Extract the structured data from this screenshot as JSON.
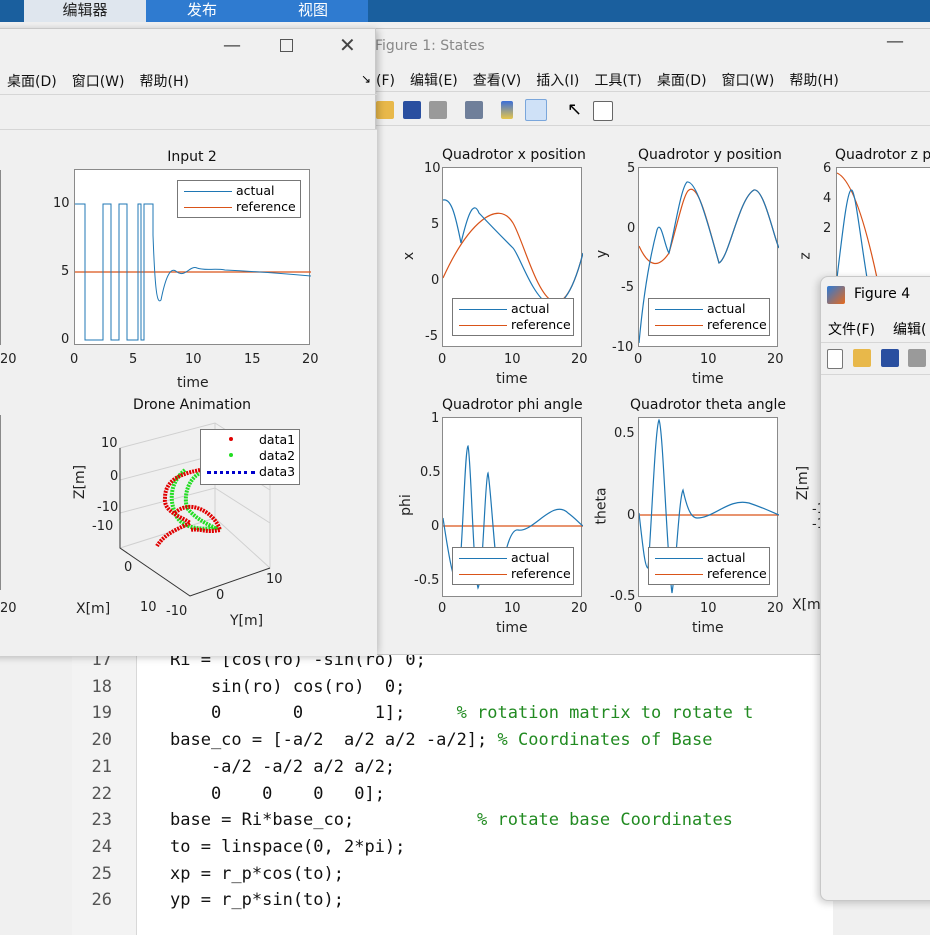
{
  "ribbon": {
    "tabs": [
      "编辑器",
      "发布",
      "视图"
    ]
  },
  "figure_left": {
    "menu": [
      "桌面(D)",
      "窗口(W)",
      "帮助(H)"
    ],
    "input2": {
      "title": "Input 2",
      "xlabel": "time",
      "xticks": [
        "0",
        "5",
        "10",
        "15",
        "20"
      ],
      "yticks": [
        "10",
        "5",
        "0"
      ],
      "legend": [
        "actual",
        "reference"
      ],
      "left_cut_xtick": "20"
    },
    "drone": {
      "title": "Drone Animation",
      "zlabel": "Z[m]",
      "xlabel": "X[m]",
      "ylabel": "Y[m]",
      "zticks": [
        "10",
        "0",
        "-10",
        "-10"
      ],
      "xticks": [
        "0",
        "10"
      ],
      "yticks": [
        "-10",
        "0",
        "10"
      ],
      "legend": [
        "data1",
        "data2",
        "data3"
      ],
      "left_cut_xtick": "20"
    }
  },
  "figure_states": {
    "title": "Figure 1: States",
    "menu": [
      "(F)",
      "编辑(E)",
      "查看(V)",
      "插入(I)",
      "工具(T)",
      "桌面(D)",
      "窗口(W)",
      "帮助(H)"
    ],
    "plots": [
      {
        "title": "Quadrotor x position",
        "ylabel": "x",
        "xlabel": "time",
        "yticks": [
          "10",
          "5",
          "0",
          "-5"
        ],
        "xticks": [
          "0",
          "10",
          "20"
        ]
      },
      {
        "title": "Quadrotor y position",
        "ylabel": "y",
        "xlabel": "time",
        "yticks": [
          "5",
          "0",
          "-5",
          "-10"
        ],
        "xticks": [
          "0",
          "10",
          "20"
        ]
      },
      {
        "title": "Quadrotor z p",
        "ylabel": "z",
        "yticks": [
          "6",
          "4",
          "2"
        ]
      },
      {
        "title": "Quadrotor phi angle",
        "ylabel": "phi",
        "xlabel": "time",
        "yticks": [
          "1",
          "0.5",
          "0",
          "-0.5"
        ],
        "xticks": [
          "0",
          "10",
          "20"
        ]
      },
      {
        "title": "Quadrotor theta angle",
        "ylabel": "theta",
        "xlabel": "time",
        "yticks": [
          "0.5",
          "0",
          "-0.5"
        ],
        "xticks": [
          "0",
          "10",
          "20"
        ]
      }
    ],
    "legend": [
      "actual",
      "reference"
    ],
    "cut_labels": {
      "zlabel": "Z[m]",
      "t1": "-1",
      "t2": "-1",
      "xlabel": "X[m"
    }
  },
  "figure4": {
    "title": "Figure 4",
    "menu": [
      "文件(F)",
      "编辑("
    ]
  },
  "editor": {
    "lines": [
      {
        "n": "17",
        "code": "Ri = [cos(ro) -sin(ro) 0;",
        "comment": ""
      },
      {
        "n": "18",
        "code": "    sin(ro) cos(ro)  0;",
        "comment": ""
      },
      {
        "n": "19",
        "code": "    0       0       1];     ",
        "comment": "% rotation matrix to rotate t"
      },
      {
        "n": "20",
        "code": "base_co = [-a/2  a/2 a/2 -a/2]; ",
        "comment": "% Coordinates of Base"
      },
      {
        "n": "21",
        "code": "    -a/2 -a/2 a/2 a/2;",
        "comment": ""
      },
      {
        "n": "22",
        "code": "    0    0    0   0];",
        "comment": ""
      },
      {
        "n": "23",
        "code": "base = Ri*base_co;            ",
        "comment": "% rotate base Coordinates"
      },
      {
        "n": "24",
        "code": "to = linspace(0, 2*pi);",
        "comment": ""
      },
      {
        "n": "25",
        "code": "xp = r_p*cos(to);",
        "comment": ""
      },
      {
        "n": "26",
        "code": "yp = r_p*sin(to);",
        "comment": ""
      }
    ]
  },
  "colors": {
    "actual": "#1f77b4",
    "reference": "#d95319",
    "data1": "#e00000",
    "data2": "#22dd22",
    "data3": "#0000cc",
    "comment": "#228b22"
  }
}
